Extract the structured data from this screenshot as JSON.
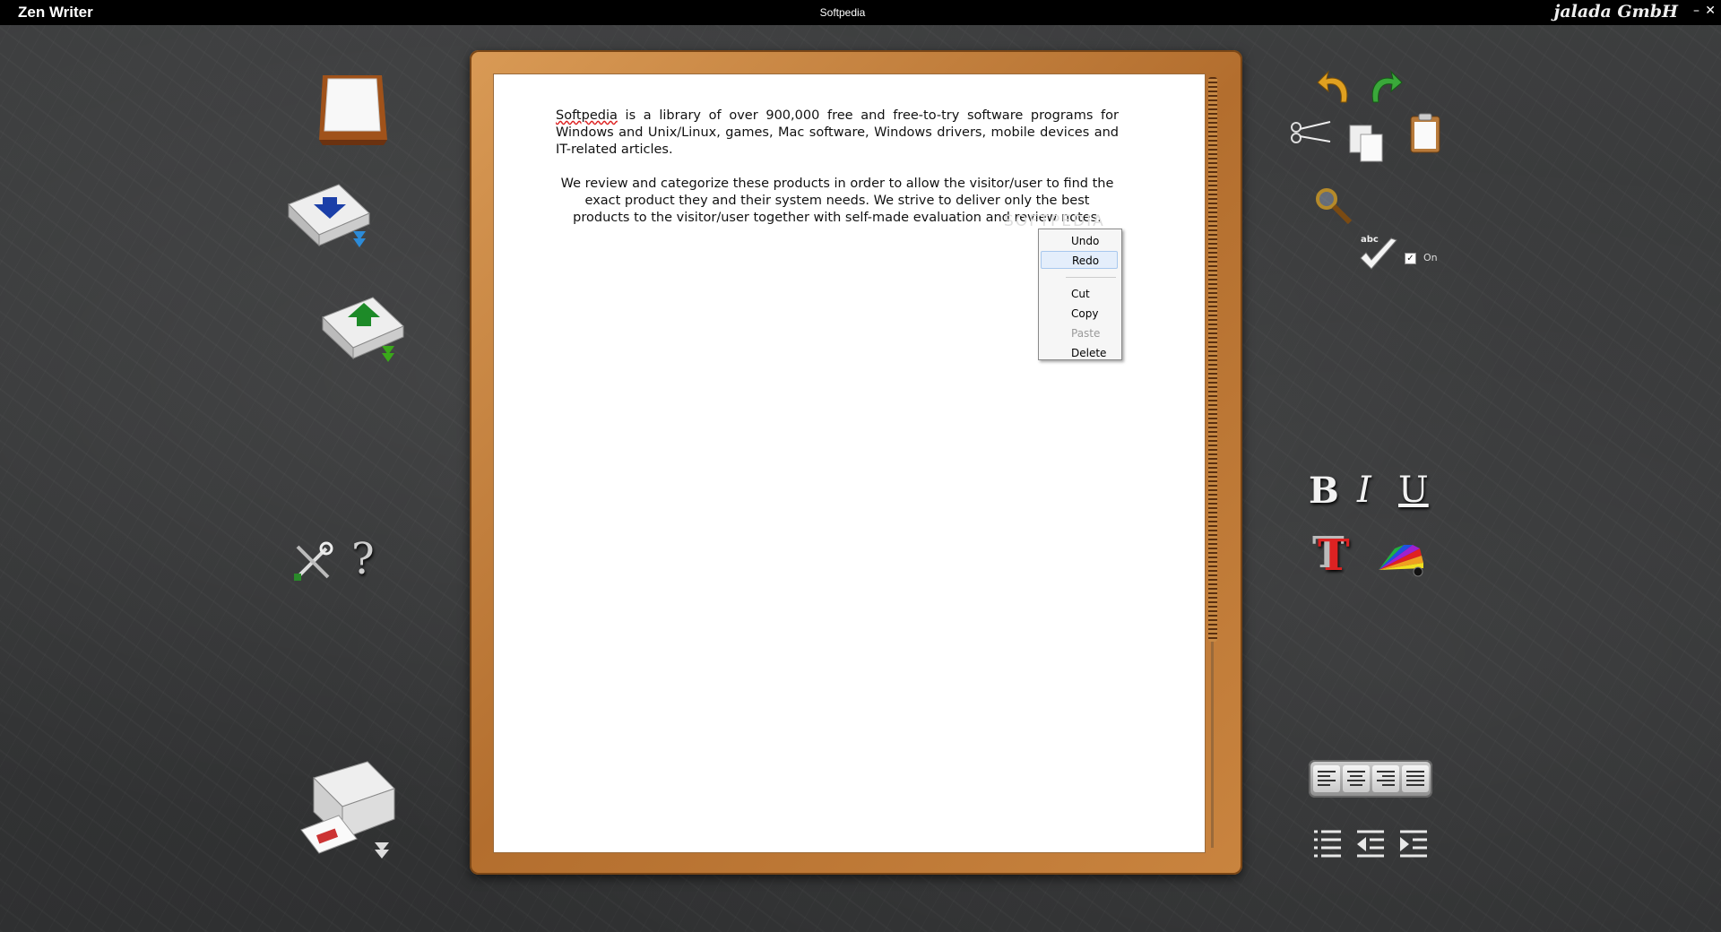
{
  "window": {
    "app_title": "Zen Writer",
    "document_title": "Softpedia",
    "brand": "jalada GmbH",
    "minimize_symbol": "–",
    "close_symbol": "✕"
  },
  "document": {
    "paragraph1_word": "Softpedia",
    "paragraph1_rest": " is a library of over 900,000 free and free-to-try software programs for Windows and Unix/Linux, games, Mac software, Windows drivers, mobile devices and IT-related articles.",
    "paragraph2": "We review and categorize these products in order to allow the visitor/user to find the exact product they and their system needs. We strive to deliver only the best products to the visitor/user together with self-made evaluation and review notes.",
    "watermark": "SOFTPEDIA"
  },
  "context_menu": {
    "items": [
      {
        "label": "Undo",
        "state": "normal"
      },
      {
        "label": "Redo",
        "state": "highlighted"
      },
      {
        "label": "Cut",
        "state": "normal"
      },
      {
        "label": "Copy",
        "state": "normal"
      },
      {
        "label": "Paste",
        "state": "disabled"
      },
      {
        "label": "Delete",
        "state": "normal"
      }
    ]
  },
  "left_toolbar": {
    "icons": [
      "new-document-icon",
      "save-icon",
      "open-icon",
      "settings-icon",
      "help-icon",
      "print-icon"
    ],
    "help_glyph": "?"
  },
  "right_toolbar": {
    "edit_icons": [
      "undo-icon",
      "redo-icon",
      "cut-icon",
      "copy-icon",
      "paste-icon",
      "search-icon",
      "spellcheck-icon"
    ],
    "spellcheck_badge": "abc",
    "spellcheck_label": "On",
    "spellcheck_checked": true,
    "check_glyph": "✓",
    "format": {
      "bold": "B",
      "italic": "I",
      "underline": "U",
      "font_glyph": "T"
    },
    "align_icons": [
      "align-left-icon",
      "align-center-icon",
      "align-right-icon",
      "align-justify-icon"
    ],
    "list_icons": [
      "bullet-list-icon",
      "outdent-icon",
      "indent-icon"
    ]
  },
  "colors": {
    "board": "#c9843f",
    "paper": "#ffffff",
    "background": "#363738",
    "menu_highlight": "#e4eefb"
  }
}
